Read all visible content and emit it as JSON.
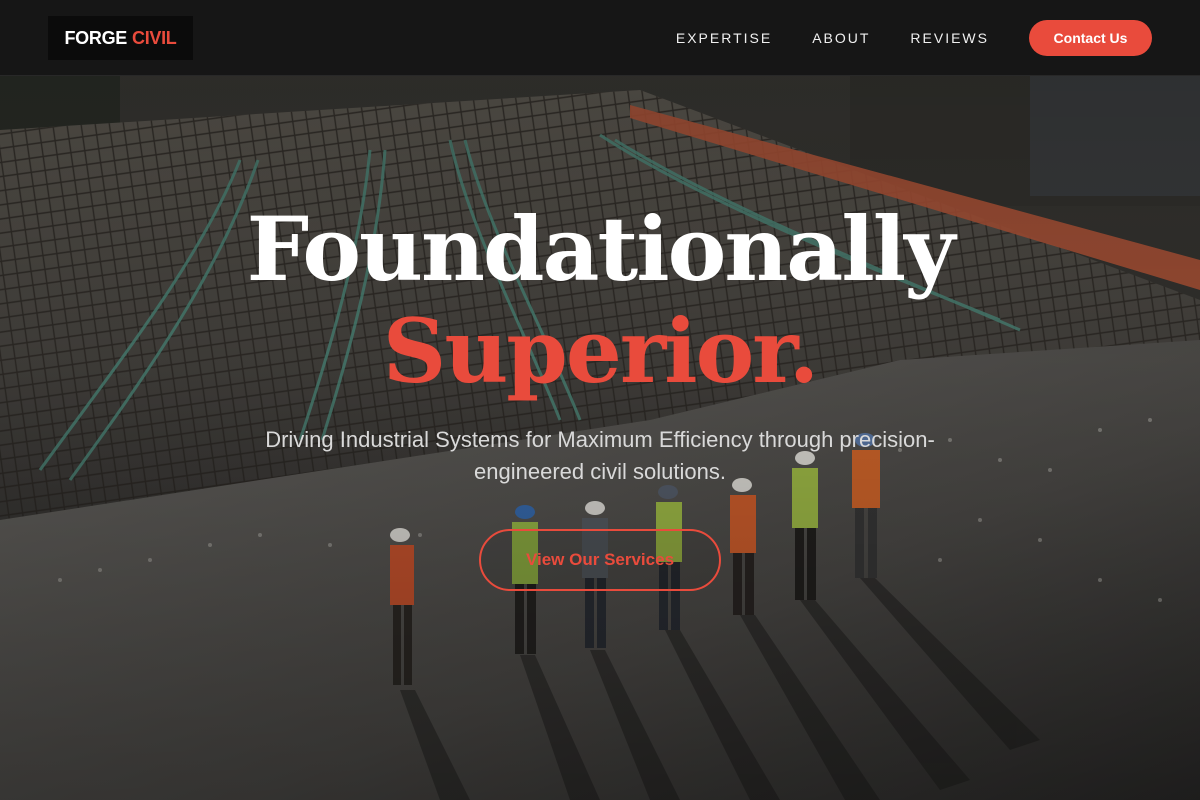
{
  "header": {
    "logo": {
      "part1": "FORGE",
      "part2": "CIVIL"
    },
    "nav": [
      {
        "label": "EXPERTISE"
      },
      {
        "label": "ABOUT"
      },
      {
        "label": "REVIEWS"
      }
    ],
    "cta_label": "Contact Us"
  },
  "hero": {
    "title_line1": "Foundationally",
    "title_line2": "Superior.",
    "subtitle": "Driving Industrial Systems for Maximum Efficiency through precision-engineered civil solutions.",
    "button_label": "View Our Services"
  },
  "colors": {
    "accent": "#e94b3c",
    "header_bg": "#161616",
    "text_light": "#ffffff"
  }
}
